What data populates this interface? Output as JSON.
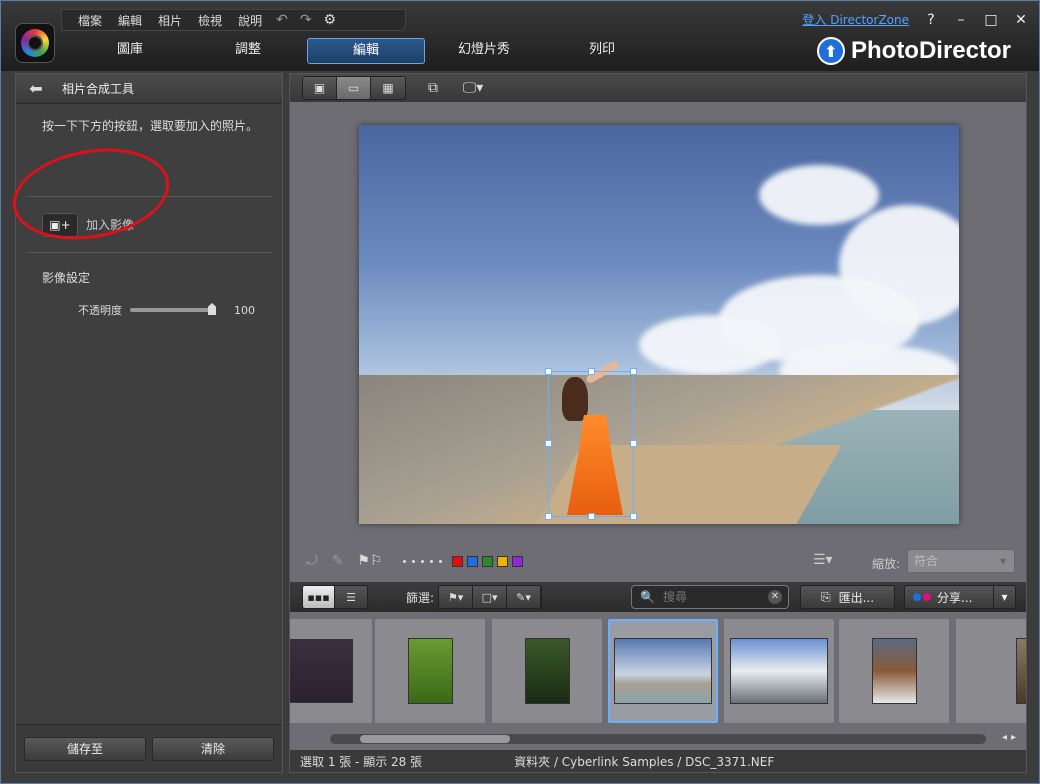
{
  "menu": {
    "items": [
      "檔案",
      "編輯",
      "相片",
      "檢視",
      "說明"
    ]
  },
  "top_right": {
    "login": "登入 DirectorZone",
    "help": "?",
    "minimize": "–",
    "maximize": "□",
    "close": "✕"
  },
  "tabs": [
    {
      "label": "圖庫",
      "active": false
    },
    {
      "label": "調整",
      "active": false
    },
    {
      "label": "編輯",
      "active": true
    },
    {
      "label": "幻燈片秀",
      "active": false
    },
    {
      "label": "列印",
      "active": false
    }
  ],
  "brand": {
    "name": "PhotoDirector"
  },
  "left_panel": {
    "title": "相片合成工具",
    "hint": "按一下下方的按鈕，選取要加入的照片。",
    "add_image": "加入影像",
    "settings_title": "影像設定",
    "opacity_label": "不透明度",
    "opacity_value": "100",
    "save_button": "儲存至",
    "clear_button": "清除"
  },
  "edit_toolbar": {
    "zoom_label": "縮放:",
    "zoom_value": "符合",
    "color_labels": [
      "#e01010",
      "#1e6fe0",
      "#2a8a2a",
      "#f0b400",
      "#8a2ad8"
    ]
  },
  "film_toolbar": {
    "filter_label": "篩選:",
    "search_placeholder": "搜尋",
    "export_label": "匯出...",
    "share_label": "分享..."
  },
  "status": {
    "selection": "選取 1 張 - 顯示 28 張",
    "path": "資料夾 / Cyberlink Samples / DSC_3371.NEF"
  },
  "icons": {
    "back": "arrow-left-icon",
    "undo": "undo-icon",
    "redo": "redo-icon",
    "settings": "gear-icon",
    "search": "search-icon",
    "export": "export-icon",
    "share_dropdown": "chevron-down-icon"
  }
}
